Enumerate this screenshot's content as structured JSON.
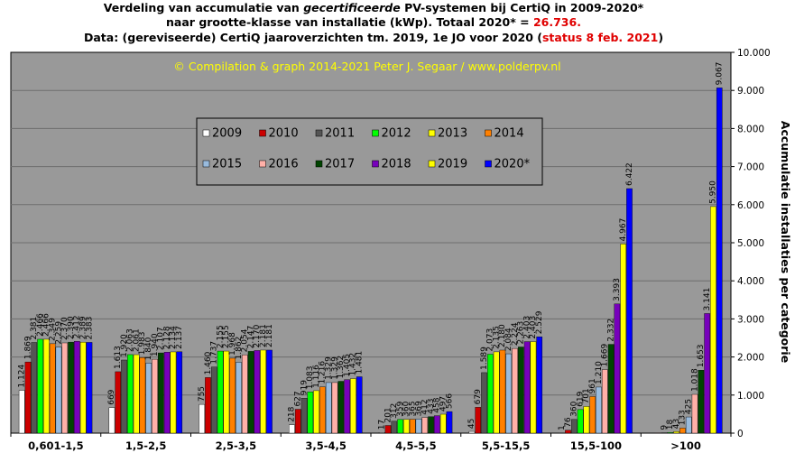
{
  "title": {
    "line1_a": "Verdeling van accumulatie van ",
    "line1_b": "gecertificeerde",
    "line1_c": " PV-systemen bij CertiQ in 2009-2020*",
    "line2_a": "naar grootte-klasse van installatie (kWp). Totaal 2020* = ",
    "line2_b": "26.736.",
    "line3_a": "Data: (gereviseerde) CertiQ jaaroverzichten tm. 2019, 1e JO voor 2020 (",
    "line3_b": "status 8 feb. 2021",
    "line3_c": ")"
  },
  "credit": "© Compilation & graph 2014-2021 Peter J. Segaar / www.polderpv.nl",
  "chart_data": {
    "type": "bar",
    "title": "Verdeling van accumulatie van gecertificeerde PV-systemen bij CertiQ in 2009-2020*",
    "ylabel": "Accumulatie installaties per categorie",
    "xlabel": "",
    "ylim": [
      0,
      10000
    ],
    "yticks": [
      "0",
      "1.000",
      "2.000",
      "3.000",
      "4.000",
      "5.000",
      "6.000",
      "7.000",
      "8.000",
      "9.000",
      "10.000"
    ],
    "y_axis_side": "right",
    "grid": true,
    "legend_position": "center-left",
    "categories": [
      "0,601-1,5",
      "1,5-2,5",
      "2,5-3,5",
      "3,5-4,5",
      "4,5-5,5",
      "5,5-15,5",
      "15,5-100",
      ">100"
    ],
    "series": [
      {
        "name": "2009",
        "color": "#ffffff",
        "values": [
          1124,
          669,
          755,
          218,
          17,
          45,
          1,
          0
        ]
      },
      {
        "name": "2010",
        "color": "#cc0000",
        "values": [
          1869,
          1613,
          1460,
          627,
          201,
          679,
          76,
          2
        ]
      },
      {
        "name": "2011",
        "color": "#555555",
        "values": [
          2381,
          1920,
          1737,
          919,
          312,
          1589,
          360,
          9
        ]
      },
      {
        "name": "2012",
        "color": "#00ff00",
        "values": [
          2466,
          2063,
          2155,
          1083,
          359,
          2073,
          619,
          18
        ]
      },
      {
        "name": "2013",
        "color": "#ffff00",
        "values": [
          2466,
          2061,
          2155,
          1116,
          360,
          2135,
          701,
          43
        ]
      },
      {
        "name": "2014",
        "color": "#ff8000",
        "values": [
          2349,
          1983,
          1968,
          1216,
          365,
          2180,
          961,
          133
        ]
      },
      {
        "name": "2015",
        "color": "#99bbdd",
        "values": [
          2259,
          1840,
          1862,
          1329,
          369,
          2084,
          1210,
          425
        ]
      },
      {
        "name": "2016",
        "color": "#ffb0a8",
        "values": [
          2370,
          1940,
          2054,
          1329,
          412,
          2224,
          1669,
          1018
        ]
      },
      {
        "name": "2017",
        "color": "#004400",
        "values": [
          2390,
          2107,
          2147,
          1362,
          433,
          2263,
          2332,
          1653
        ]
      },
      {
        "name": "2018",
        "color": "#7700bb",
        "values": [
          2412,
          2128,
          2170,
          1405,
          458,
          2403,
          3393,
          3141
        ]
      },
      {
        "name": "2019",
        "color": "#ffff00",
        "values": [
          2389,
          2134,
          2181,
          1432,
          497,
          2403,
          4967,
          5950
        ]
      },
      {
        "name": "2020*",
        "color": "#0000ff",
        "values": [
          2383,
          2137,
          2181,
          1481,
          566,
          2529,
          6422,
          9067
        ]
      }
    ],
    "data_labels": [
      [
        "1.124",
        "1.869",
        "2.381",
        "2.466",
        "2.466",
        "2.349",
        "2.259",
        "2.370",
        "2.390",
        "2.412",
        "2.389",
        "2.383"
      ],
      [
        "669",
        "1.613",
        "1.920",
        "2.063",
        "2.061",
        "1.983",
        "1.840",
        "1.940",
        "2.107",
        "2.128",
        "2.134",
        "2.137"
      ],
      [
        "755",
        "1.460",
        "1.737",
        "2.155",
        "2.155",
        "1.968",
        "1.862",
        "2.054",
        "2.147",
        "2.170",
        "2.181",
        "2.181"
      ],
      [
        "218",
        "627",
        "919",
        "1.083",
        "1.116",
        "1.216",
        "1.329",
        "1.329",
        "1.362",
        "1.405",
        "1.432",
        "1.481"
      ],
      [
        "17",
        "201",
        "312",
        "359",
        "360",
        "365",
        "369",
        "412",
        "433",
        "458",
        "497",
        "566"
      ],
      [
        "45",
        "679",
        "1.589",
        "2.073",
        "2.135",
        "2.180",
        "2.084",
        "2.224",
        "2.263",
        "2.403",
        "2.403",
        "2.529"
      ],
      [
        "1",
        "76",
        "360",
        "619",
        "701",
        "961",
        "1.210",
        "1.669",
        "2.332",
        "3.393",
        "4.967",
        "6.422"
      ],
      [
        "",
        "",
        "9",
        "18",
        "43",
        "133",
        "425",
        "1.018",
        "1.653",
        "3.141",
        "5.950",
        "9.067"
      ]
    ],
    "colors": {
      "plot_background": "#999999",
      "gridline": "#6e6e6e",
      "legend_background": "#999999",
      "credit_text": "#ffff00",
      "highlight_text": "#e00000"
    }
  }
}
